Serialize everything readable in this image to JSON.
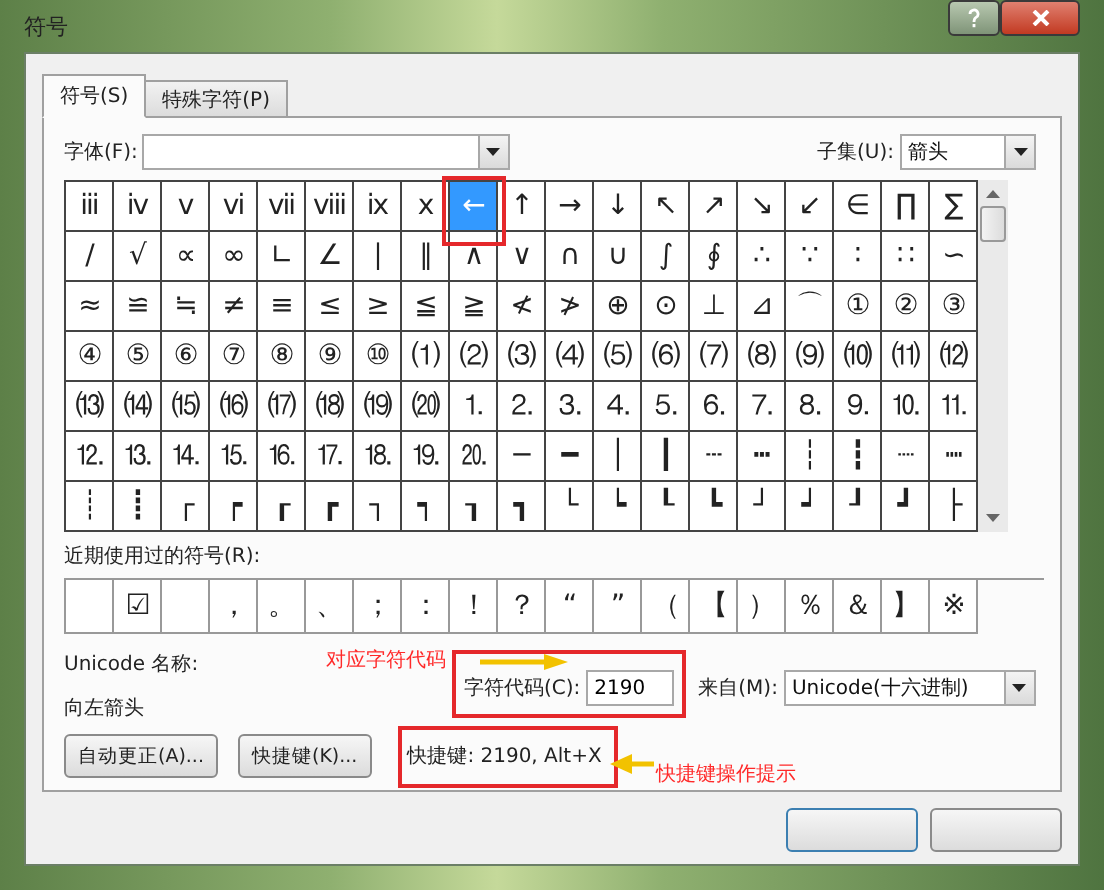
{
  "window": {
    "title": "符号"
  },
  "tabs": [
    {
      "label": "符号(S)",
      "selected": true
    },
    {
      "label": "特殊字符(P)",
      "selected": false
    }
  ],
  "font": {
    "label": "字体(F):"
  },
  "subset": {
    "label": "子集(U):",
    "value": "箭头"
  },
  "grid": [
    [
      {
        "c": "iii",
        "selected": false
      },
      {
        "c": "iv",
        "selected": false
      },
      {
        "c": "v",
        "selected": false
      },
      {
        "c": "vi",
        "selected": false
      },
      {
        "c": "vii",
        "selected": false
      },
      {
        "c": "viii",
        "selected": false
      },
      {
        "c": "ix",
        "selected": false
      },
      {
        "c": "x",
        "selected": false
      },
      {
        "c": "←",
        "selected": true
      },
      {
        "c": "↑",
        "selected": false
      },
      {
        "c": "→",
        "selected": false
      },
      {
        "c": "↓",
        "selected": false
      },
      {
        "c": "↖",
        "selected": false
      },
      {
        "c": "↗",
        "selected": false
      },
      {
        "c": "↘",
        "selected": false
      },
      {
        "c": "↙",
        "selected": false
      },
      {
        "c": "∈",
        "selected": false
      },
      {
        "c": "∏",
        "selected": false
      },
      {
        "c": "∑",
        "selected": false
      }
    ],
    [
      {
        "c": "∕",
        "selected": false
      },
      {
        "c": "√",
        "selected": false
      },
      {
        "c": "∝",
        "selected": false
      },
      {
        "c": "∞",
        "selected": false
      },
      {
        "c": "∟",
        "selected": false
      },
      {
        "c": "∠",
        "selected": false
      },
      {
        "c": "∣",
        "selected": false
      },
      {
        "c": "∥",
        "selected": false
      },
      {
        "c": "∧",
        "selected": false
      },
      {
        "c": "∨",
        "selected": false
      },
      {
        "c": "∩",
        "selected": false
      },
      {
        "c": "∪",
        "selected": false
      },
      {
        "c": "∫",
        "selected": false
      },
      {
        "c": "∮",
        "selected": false
      },
      {
        "c": "∴",
        "selected": false
      },
      {
        "c": "∵",
        "selected": false
      },
      {
        "c": "∶",
        "selected": false
      },
      {
        "c": "∷",
        "selected": false
      },
      {
        "c": "∽",
        "selected": false
      }
    ],
    [
      {
        "c": "≈",
        "selected": false
      },
      {
        "c": "≌",
        "selected": false
      },
      {
        "c": "≒",
        "selected": false
      },
      {
        "c": "≠",
        "selected": false
      },
      {
        "c": "≡",
        "selected": false
      },
      {
        "c": "≤",
        "selected": false
      },
      {
        "c": "≥",
        "selected": false
      },
      {
        "c": "≦",
        "selected": false
      },
      {
        "c": "≧",
        "selected": false
      },
      {
        "c": "≮",
        "selected": false
      },
      {
        "c": "≯",
        "selected": false
      },
      {
        "c": "⊕",
        "selected": false
      },
      {
        "c": "⊙",
        "selected": false
      },
      {
        "c": "⊥",
        "selected": false
      },
      {
        "c": "⊿",
        "selected": false
      },
      {
        "c": "⌒",
        "selected": false
      },
      {
        "c": "①",
        "selected": false
      },
      {
        "c": "②",
        "selected": false
      },
      {
        "c": "③",
        "selected": false
      }
    ],
    [
      {
        "c": "④",
        "selected": false
      },
      {
        "c": "⑤",
        "selected": false
      },
      {
        "c": "⑥",
        "selected": false
      },
      {
        "c": "⑦",
        "selected": false
      },
      {
        "c": "⑧",
        "selected": false
      },
      {
        "c": "⑨",
        "selected": false
      },
      {
        "c": "⑩",
        "selected": false
      },
      {
        "c": "⑴",
        "selected": false
      },
      {
        "c": "⑵",
        "selected": false
      },
      {
        "c": "⑶",
        "selected": false
      },
      {
        "c": "⑷",
        "selected": false
      },
      {
        "c": "⑸",
        "selected": false
      },
      {
        "c": "⑹",
        "selected": false
      },
      {
        "c": "⑺",
        "selected": false
      },
      {
        "c": "⑻",
        "selected": false
      },
      {
        "c": "⑼",
        "selected": false
      },
      {
        "c": "⑽",
        "selected": false
      },
      {
        "c": "⑾",
        "selected": false
      },
      {
        "c": "⑿",
        "selected": false
      }
    ],
    [
      {
        "c": "⒀",
        "selected": false
      },
      {
        "c": "⒁",
        "selected": false
      },
      {
        "c": "⒂",
        "selected": false
      },
      {
        "c": "⒃",
        "selected": false
      },
      {
        "c": "⒄",
        "selected": false
      },
      {
        "c": "⒅",
        "selected": false
      },
      {
        "c": "⒆",
        "selected": false
      },
      {
        "c": "⒇",
        "selected": false
      },
      {
        "c": "⒈",
        "selected": false
      },
      {
        "c": "⒉",
        "selected": false
      },
      {
        "c": "⒊",
        "selected": false
      },
      {
        "c": "⒋",
        "selected": false
      },
      {
        "c": "⒌",
        "selected": false
      },
      {
        "c": "⒍",
        "selected": false
      },
      {
        "c": "⒎",
        "selected": false
      },
      {
        "c": "⒏",
        "selected": false
      },
      {
        "c": "⒐",
        "selected": false
      },
      {
        "c": "⒑",
        "selected": false
      },
      {
        "c": "⒒",
        "selected": false
      }
    ],
    [
      {
        "c": "⒓",
        "selected": false
      },
      {
        "c": "⒔",
        "selected": false
      },
      {
        "c": "⒕",
        "selected": false
      },
      {
        "c": "⒖",
        "selected": false
      },
      {
        "c": "⒗",
        "selected": false
      },
      {
        "c": "⒘",
        "selected": false
      },
      {
        "c": "⒙",
        "selected": false
      },
      {
        "c": "⒚",
        "selected": false
      },
      {
        "c": "⒛",
        "selected": false
      },
      {
        "c": "─",
        "selected": false
      },
      {
        "c": "━",
        "selected": false
      },
      {
        "c": "│",
        "selected": false
      },
      {
        "c": "┃",
        "selected": false
      },
      {
        "c": "┄",
        "selected": false
      },
      {
        "c": "┅",
        "selected": false
      },
      {
        "c": "┆",
        "selected": false
      },
      {
        "c": "┇",
        "selected": false
      },
      {
        "c": "┈",
        "selected": false
      },
      {
        "c": "┉",
        "selected": false
      }
    ],
    [
      {
        "c": "┊",
        "selected": false
      },
      {
        "c": "┋",
        "selected": false
      },
      {
        "c": "┌",
        "selected": false
      },
      {
        "c": "┍",
        "selected": false
      },
      {
        "c": "┎",
        "selected": false
      },
      {
        "c": "┏",
        "selected": false
      },
      {
        "c": "┐",
        "selected": false
      },
      {
        "c": "┑",
        "selected": false
      },
      {
        "c": "┒",
        "selected": false
      },
      {
        "c": "┓",
        "selected": false
      },
      {
        "c": "└",
        "selected": false
      },
      {
        "c": "┕",
        "selected": false
      },
      {
        "c": "┖",
        "selected": false
      },
      {
        "c": "┗",
        "selected": false
      },
      {
        "c": "┘",
        "selected": false
      },
      {
        "c": "┙",
        "selected": false
      },
      {
        "c": "┚",
        "selected": false
      },
      {
        "c": "┛",
        "selected": false
      },
      {
        "c": "├",
        "selected": false
      }
    ]
  ],
  "recent": {
    "label": "近期使用过的符号(R):",
    "symbols": [
      {
        "kind": "blank"
      },
      {
        "kind": "char",
        "c": "☑"
      },
      {
        "kind": "blank"
      },
      {
        "kind": "char",
        "c": "，"
      },
      {
        "kind": "char",
        "c": "。"
      },
      {
        "kind": "char",
        "c": "、"
      },
      {
        "kind": "char",
        "c": "；"
      },
      {
        "kind": "char",
        "c": "："
      },
      {
        "kind": "char",
        "c": "！"
      },
      {
        "kind": "char",
        "c": "？"
      },
      {
        "kind": "char",
        "c": "“"
      },
      {
        "kind": "char",
        "c": "”"
      },
      {
        "kind": "char",
        "c": "（"
      },
      {
        "kind": "char",
        "c": "【"
      },
      {
        "kind": "char",
        "c": "）"
      },
      {
        "kind": "char",
        "c": "％"
      },
      {
        "kind": "char",
        "c": "＆"
      },
      {
        "kind": "char",
        "c": "】"
      },
      {
        "kind": "char",
        "c": "※"
      }
    ]
  },
  "unicode_name": {
    "label": "Unicode 名称:",
    "value": "向左箭头"
  },
  "char_code": {
    "label": "字符代码(C):",
    "value": "2190"
  },
  "from": {
    "label": "来自(M):",
    "value": "Unicode(十六进制)"
  },
  "buttons": [
    "自动更正(A)...",
    "快捷键(K)..."
  ],
  "shortcut": "快捷键: 2190, Alt+X",
  "annotations": {
    "code_note": "对应字符代码",
    "shortcut_note": "快捷键操作提示"
  }
}
